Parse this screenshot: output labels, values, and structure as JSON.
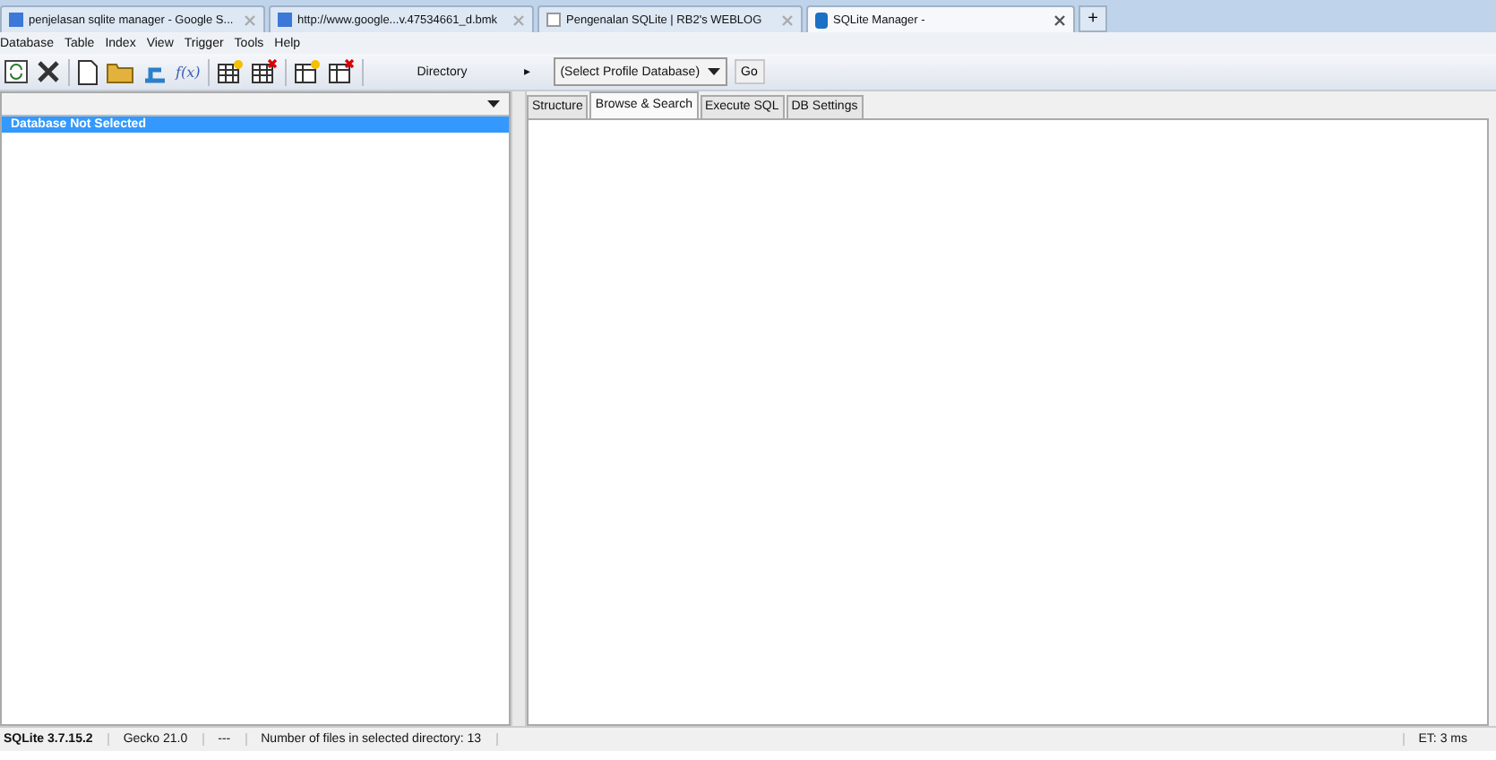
{
  "browser_tabs": [
    {
      "label": "penjelasan sqlite manager - Google S...",
      "kind": "google",
      "selected": false
    },
    {
      "label": "http://www.google...v.47534661_d.bmk",
      "kind": "google",
      "selected": false
    },
    {
      "label": "Pengenalan SQLite | RB2's WEBLOG",
      "kind": "blank",
      "selected": false
    },
    {
      "label": "SQLite Manager -",
      "kind": "db",
      "selected": true
    }
  ],
  "new_tab": "+",
  "menu": [
    "Database",
    "Table",
    "Index",
    "View",
    "Trigger",
    "Tools",
    "Help"
  ],
  "toolbar": {
    "fx": "f(x)",
    "directory_label": "Directory",
    "arrow": "▸",
    "profile_select": "(Select Profile Database)",
    "go": "Go"
  },
  "sidebar": {
    "items": [
      {
        "label": "Database Not Selected",
        "selected": true
      }
    ]
  },
  "tabs": [
    {
      "label": "Structure",
      "selected": false
    },
    {
      "label": "Browse & Search",
      "selected": true
    },
    {
      "label": "Execute SQL",
      "selected": false
    },
    {
      "label": "DB Settings",
      "selected": false
    }
  ],
  "status_bar": [
    "SQLite 3.7.15.2",
    "Gecko 21.0",
    "---",
    "Number of files in selected directory: 13"
  ],
  "status_right": "ET: 3 ms"
}
